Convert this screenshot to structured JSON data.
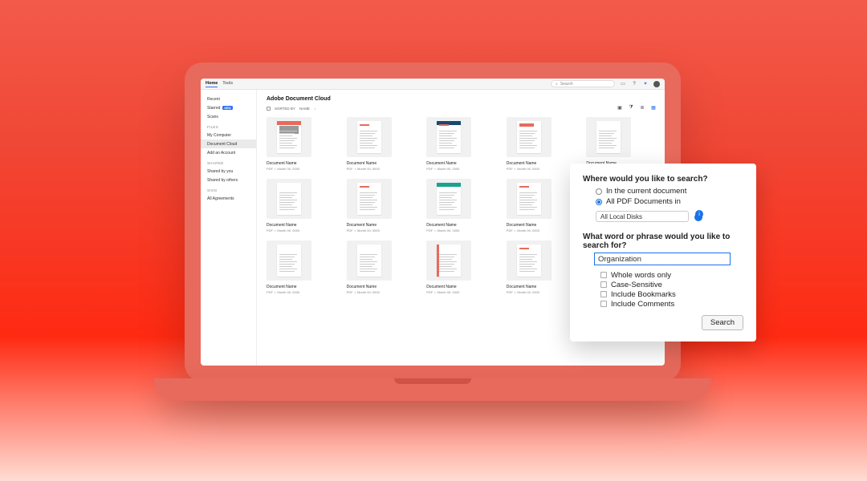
{
  "titlebar": {
    "tabs": [
      "Home",
      "Tools"
    ],
    "search_placeholder": "Search",
    "icons": {
      "chat": "chat-icon",
      "help": "help-icon",
      "bell": "bell-icon"
    }
  },
  "sidebar": {
    "top": [
      {
        "label": "Recent"
      },
      {
        "label": "Starred",
        "badge": "NEW"
      },
      {
        "label": "Scans"
      }
    ],
    "files_h": "FILES",
    "files": [
      {
        "label": "My Computer"
      },
      {
        "label": "Document Cloud",
        "active": true
      },
      {
        "label": "Add an Account"
      }
    ],
    "shared_h": "SHARED",
    "shared": [
      {
        "label": "Shared by you"
      },
      {
        "label": "Shared by others"
      }
    ],
    "sign_h": "SIGN",
    "sign": [
      {
        "label": "All Agreements"
      }
    ]
  },
  "main": {
    "title": "Adobe Document Cloud",
    "sorted_by_label": "SORTED BY",
    "sorted_by_value": "NAME",
    "doc_name": "Document Name",
    "doc_type": "PDF",
    "doc_date": "Month 00, 0000"
  },
  "panel": {
    "q1": "Where would you like to search?",
    "r1": "In the current document",
    "r2": "All PDF Documents in",
    "dropdown": "All Local Disks",
    "q2": "What word or phrase would you like to search for?",
    "input_value": "Organization",
    "c1": "Whole words only",
    "c2": "Case-Sensitive",
    "c3": "Include Bookmarks",
    "c4": "Include Comments",
    "btn": "Search"
  }
}
